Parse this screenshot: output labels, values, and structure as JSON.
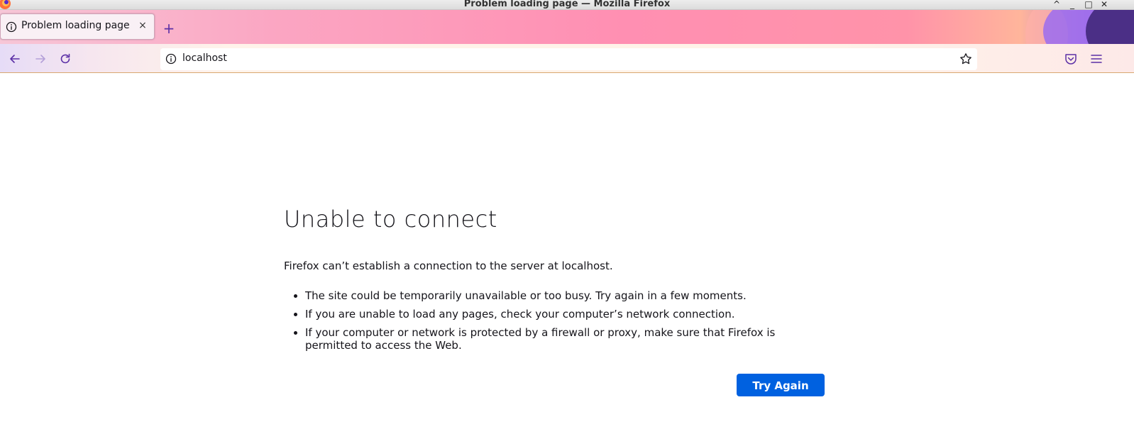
{
  "window": {
    "title": "Problem loading page — Mozilla Firefox",
    "controls": [
      "^",
      "_",
      "□",
      "✕"
    ]
  },
  "tab": {
    "label": "Problem loading page",
    "close": "×",
    "new_tab": "+"
  },
  "urlbar": {
    "url": "localhost"
  },
  "error": {
    "title": "Unable to connect",
    "description": "Firefox can’t establish a connection to the server at localhost.",
    "bullets": [
      "The site could be temporarily unavailable or too busy. Try again in a few moments.",
      "If you are unable to load any pages, check your computer’s network connection.",
      "If your computer or network is protected by a firewall or proxy, make sure that Firefox is permitted to access the Web."
    ],
    "button": "Try Again"
  },
  "colors": {
    "accent": "#0061e0",
    "tab_icon": "#5b2fa6"
  },
  "icons": {
    "app": "firefox-logo-icon",
    "tab": "info-icon",
    "back": "back-arrow-icon",
    "forward": "forward-arrow-icon",
    "reload": "reload-icon",
    "bookmark": "star-icon",
    "pocket": "pocket-icon",
    "menu": "hamburger-menu-icon"
  }
}
